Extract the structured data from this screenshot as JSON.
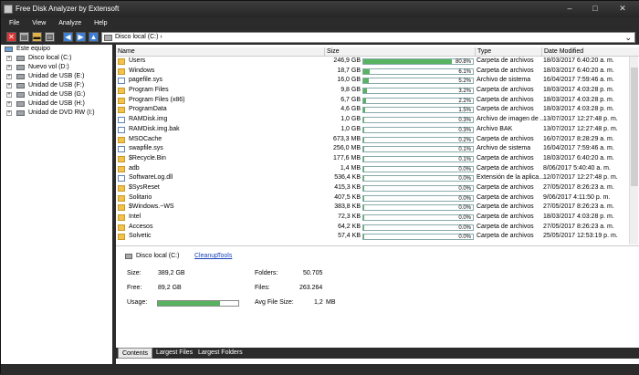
{
  "title": "Free Disk Analyzer by Extensoft",
  "window_controls": {
    "minimize": "–",
    "maximize": "□",
    "close": "✕"
  },
  "menu": [
    "File",
    "View",
    "Analyze",
    "Help"
  ],
  "address": {
    "path": "Disco local (C:)"
  },
  "tree": {
    "root": "Este equipo",
    "items": [
      "Disco local (C:)",
      "Nuevo vol (D:)",
      "Unidad de USB (E:)",
      "Unidad de USB (F:)",
      "Unidad de USB (G:)",
      "Unidad de USB (H:)",
      "Unidad de DVD RW (I:)"
    ]
  },
  "columns": {
    "name": "Name",
    "size": "Size",
    "type": "Type",
    "date": "Date Modified"
  },
  "rows": [
    {
      "name": "Users",
      "size": "246,9 GB",
      "pct": 80.8,
      "pct_label": "80.8%",
      "type": "Carpeta de archivos",
      "date": "18/03/2017 6:40:20 a. m.",
      "folder": true
    },
    {
      "name": "Windows",
      "size": "18,7 GB",
      "pct": 6.1,
      "pct_label": "6.1%",
      "type": "Carpeta de archivos",
      "date": "18/03/2017 6:40:20 a. m.",
      "folder": true
    },
    {
      "name": "pagefile.sys",
      "size": "16,0 GB",
      "pct": 5.2,
      "pct_label": "5.2%",
      "type": "Archivo de sistema",
      "date": "16/04/2017 7:59:46 a. m.",
      "folder": false
    },
    {
      "name": "Program Files",
      "size": "9,8 GB",
      "pct": 3.2,
      "pct_label": "3.2%",
      "type": "Carpeta de archivos",
      "date": "18/03/2017 4:03:28 p. m.",
      "folder": true
    },
    {
      "name": "Program Files (x86)",
      "size": "6,7 GB",
      "pct": 2.2,
      "pct_label": "2.2%",
      "type": "Carpeta de archivos",
      "date": "18/03/2017 4:03:28 p. m.",
      "folder": true
    },
    {
      "name": "ProgramData",
      "size": "4,6 GB",
      "pct": 1.5,
      "pct_label": "1.5%",
      "type": "Carpeta de archivos",
      "date": "18/03/2017 4:03:28 p. m.",
      "folder": true
    },
    {
      "name": "RAMDisk.img",
      "size": "1,0 GB",
      "pct": 0.3,
      "pct_label": "0.3%",
      "type": "Archivo de imagen de ...",
      "date": "13/07/2017 12:27:48 p. m.",
      "folder": false
    },
    {
      "name": "RAMDisk.img.bak",
      "size": "1,0 GB",
      "pct": 0.3,
      "pct_label": "0.3%",
      "type": "Archivo BAK",
      "date": "13/07/2017 12:27:48 p. m.",
      "folder": false
    },
    {
      "name": "MSOCache",
      "size": "673,3 MB",
      "pct": 0.2,
      "pct_label": "0.2%",
      "type": "Carpeta de archivos",
      "date": "16/07/2017 8:28:29 a. m.",
      "folder": true
    },
    {
      "name": "swapfile.sys",
      "size": "256,0 MB",
      "pct": 0.1,
      "pct_label": "0.1%",
      "type": "Archivo de sistema",
      "date": "16/04/2017 7:59:46 a. m.",
      "folder": false
    },
    {
      "name": "$Recycle.Bin",
      "size": "177,6 MB",
      "pct": 0.1,
      "pct_label": "0.1%",
      "type": "Carpeta de archivos",
      "date": "18/03/2017 6:40:20 a. m.",
      "folder": true
    },
    {
      "name": "adb",
      "size": "1,4 MB",
      "pct": 0.0,
      "pct_label": "0.0%",
      "type": "Carpeta de archivos",
      "date": "8/06/2017 5:40:40 a. m.",
      "folder": true
    },
    {
      "name": "SoftwareLog.dll",
      "size": "536,4 KB",
      "pct": 0.0,
      "pct_label": "0.0%",
      "type": "Extensión de la aplica...",
      "date": "12/07/2017 12:27:48 p. m.",
      "folder": false
    },
    {
      "name": "$SysReset",
      "size": "415,3 KB",
      "pct": 0.0,
      "pct_label": "0.0%",
      "type": "Carpeta de archivos",
      "date": "27/05/2017 8:26:23 a. m.",
      "folder": true
    },
    {
      "name": "Solitario",
      "size": "407,5 KB",
      "pct": 0.0,
      "pct_label": "0.0%",
      "type": "Carpeta de archivos",
      "date": "9/06/2017 4:11:50 p. m.",
      "folder": true
    },
    {
      "name": "$Windows.~WS",
      "size": "383,8 KB",
      "pct": 0.0,
      "pct_label": "0.0%",
      "type": "Carpeta de archivos",
      "date": "27/05/2017 8:26:23 a. m.",
      "folder": true
    },
    {
      "name": "Intel",
      "size": "72,3 KB",
      "pct": 0.0,
      "pct_label": "0.0%",
      "type": "Carpeta de archivos",
      "date": "18/03/2017 4:03:28 p. m.",
      "folder": true
    },
    {
      "name": "Accesos",
      "size": "64,2 KB",
      "pct": 0.0,
      "pct_label": "0.0%",
      "type": "Carpeta de archivos",
      "date": "27/05/2017 8:26:23 a. m.",
      "folder": true
    },
    {
      "name": "Solvetic",
      "size": "57,4 KB",
      "pct": 0.0,
      "pct_label": "0.0%",
      "type": "Carpeta de archivos",
      "date": "25/05/2017 12:53:19 p. m.",
      "folder": true
    }
  ],
  "summary": {
    "drive": "Disco local (C:)",
    "cleanup": "Cleanup",
    "tools": "Tools",
    "size_label": "Size:",
    "size_value": "389,2 GB",
    "free_label": "Free:",
    "free_value": "89,2 GB",
    "usage_label": "Usage:",
    "usage_fraction": 0.77,
    "folders_label": "Folders:",
    "folders_value": "50.705",
    "files_label": "Files:",
    "files_value": "263.264",
    "avg_label": "Avg File Size:",
    "avg_value": "1,2",
    "avg_unit": "MB"
  },
  "tabs": [
    "Contents",
    "Largest Files",
    "Largest Folders"
  ],
  "colors": {
    "bar_fill": "#57b35f",
    "link": "#1a45b8",
    "folder": "#f2c14e"
  }
}
